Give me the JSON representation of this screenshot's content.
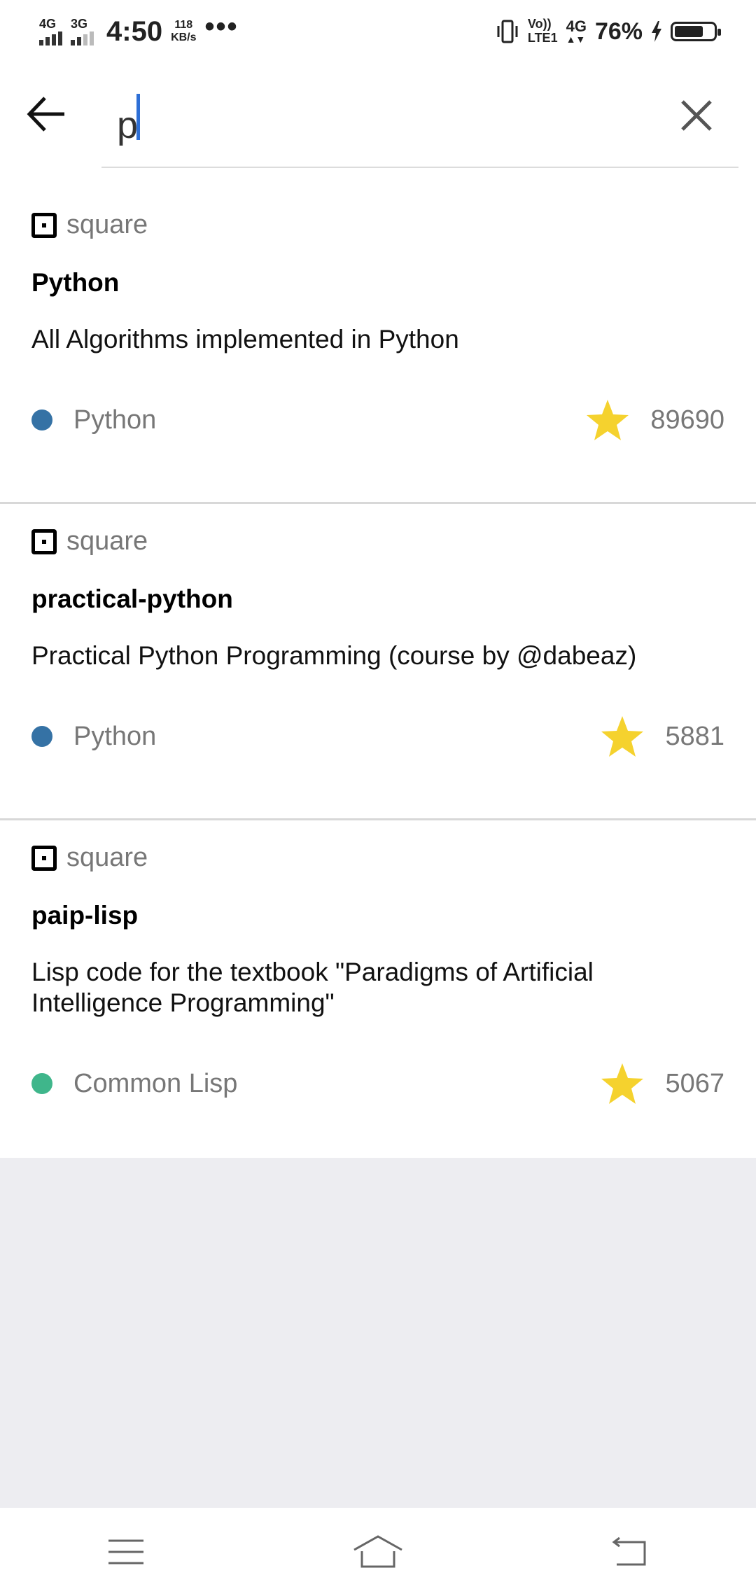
{
  "status_bar": {
    "net1": "4G",
    "net2": "3G",
    "time": "4:50",
    "speed_value": "118",
    "speed_unit": "KB/s",
    "more": "•••",
    "volte_top": "Vo))",
    "volte_bottom": "LTE1",
    "net3": "4G",
    "battery_percent": "76%",
    "battery_level": 0.76
  },
  "search": {
    "query": "p"
  },
  "results": [
    {
      "owner": "square",
      "name": "Python",
      "description": "All Algorithms implemented in Python",
      "language": "Python",
      "language_color": "#3572A5",
      "stars": "89690"
    },
    {
      "owner": "square",
      "name": "practical-python",
      "description": "Practical Python Programming (course by @dabeaz)",
      "language": "Python",
      "language_color": "#3572A5",
      "stars": "5881"
    },
    {
      "owner": "square",
      "name": "paip-lisp",
      "description": "Lisp code for the textbook \"Paradigms of Artificial Intelligence Programming\"",
      "language": "Common Lisp",
      "language_color": "#3fb68b",
      "stars": "5067"
    }
  ],
  "colors": {
    "star": "#f5d22e",
    "caret": "#2d6fd6",
    "empty_background": "#ededf1"
  },
  "icons": {
    "back": "arrow-left-icon",
    "clear": "close-icon",
    "star": "star-icon",
    "owner_logo": "square-logo-icon",
    "nav_menu": "menu-icon",
    "nav_home": "home-icon",
    "nav_back": "back-icon"
  }
}
